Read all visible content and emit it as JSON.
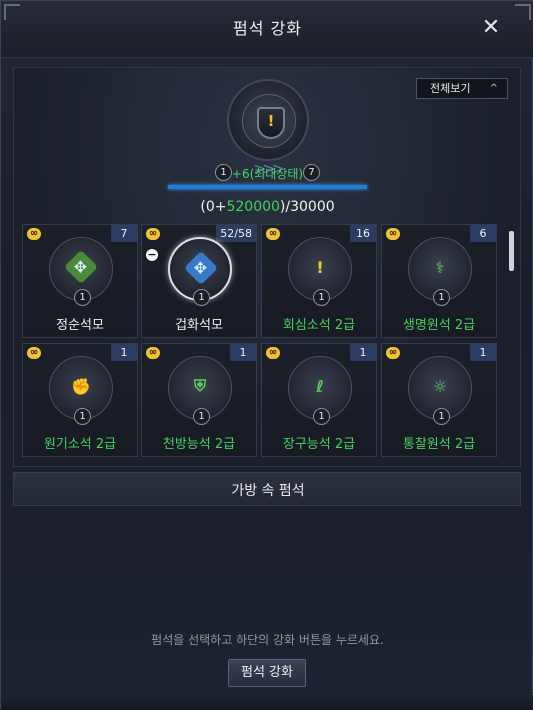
{
  "window": {
    "title": "펌석 강화",
    "close_glyph": "✕"
  },
  "view_all": {
    "label": "전체보기",
    "chevron": "^"
  },
  "main_item": {
    "icon": "shield-exclamation-icon",
    "level_left": "1",
    "level_right": "7",
    "level_text": "+6(최대상태)",
    "progress_text_open": "(0+",
    "progress_bonus": "520000",
    "progress_text_close": ")/30000",
    "progress_fraction": 1.0
  },
  "grid": [
    {
      "name": "정순석모",
      "count": "7",
      "level": "1",
      "name_color": "white",
      "gem_color": "#4a8b3a",
      "gem_glyph": "✥",
      "icon": "green-diamond-gem-icon"
    },
    {
      "name": "겁화석모",
      "count": "52/58",
      "level": "1",
      "name_color": "white",
      "gem_color": "#3a79c9",
      "gem_glyph": "✥",
      "icon": "blue-diamond-gem-icon",
      "selected": true,
      "minus": "−"
    },
    {
      "name": "회심소석 2급",
      "count": "16",
      "level": "1",
      "name_color": "green",
      "gem_color": "#2f3544",
      "gem_glyph": "!",
      "icon": "shield-exclamation-gem-icon"
    },
    {
      "name": "생명원석 2급",
      "count": "6",
      "level": "1",
      "name_color": "green",
      "gem_color": "#2f3544",
      "gem_glyph": "⚕",
      "icon": "bone-gem-icon"
    },
    {
      "name": "원기소석 2급",
      "count": "1",
      "level": "1",
      "name_color": "green",
      "gem_color": "#2f3544",
      "gem_glyph": "✊",
      "icon": "fist-gem-icon"
    },
    {
      "name": "천방능석 2급",
      "count": "1",
      "level": "1",
      "name_color": "green",
      "gem_color": "#2f3544",
      "gem_glyph": "⛨",
      "icon": "shield-gem-icon"
    },
    {
      "name": "장구능석 2급",
      "count": "1",
      "level": "1",
      "name_color": "green",
      "gem_color": "#2f3544",
      "gem_glyph": "ℓ",
      "icon": "swirl-gem-icon"
    },
    {
      "name": "통찰원석 2급",
      "count": "1",
      "level": "1",
      "name_color": "green",
      "gem_color": "#2f3544",
      "gem_glyph": "☼",
      "icon": "eye-gem-icon"
    }
  ],
  "inf_glyph": "∞",
  "bag_section": {
    "title": "가방 속 펌석"
  },
  "hint": "펌석을 선택하고 하단의 강화 버튼을 누르세요.",
  "enhance_button": "펌석 강화"
}
